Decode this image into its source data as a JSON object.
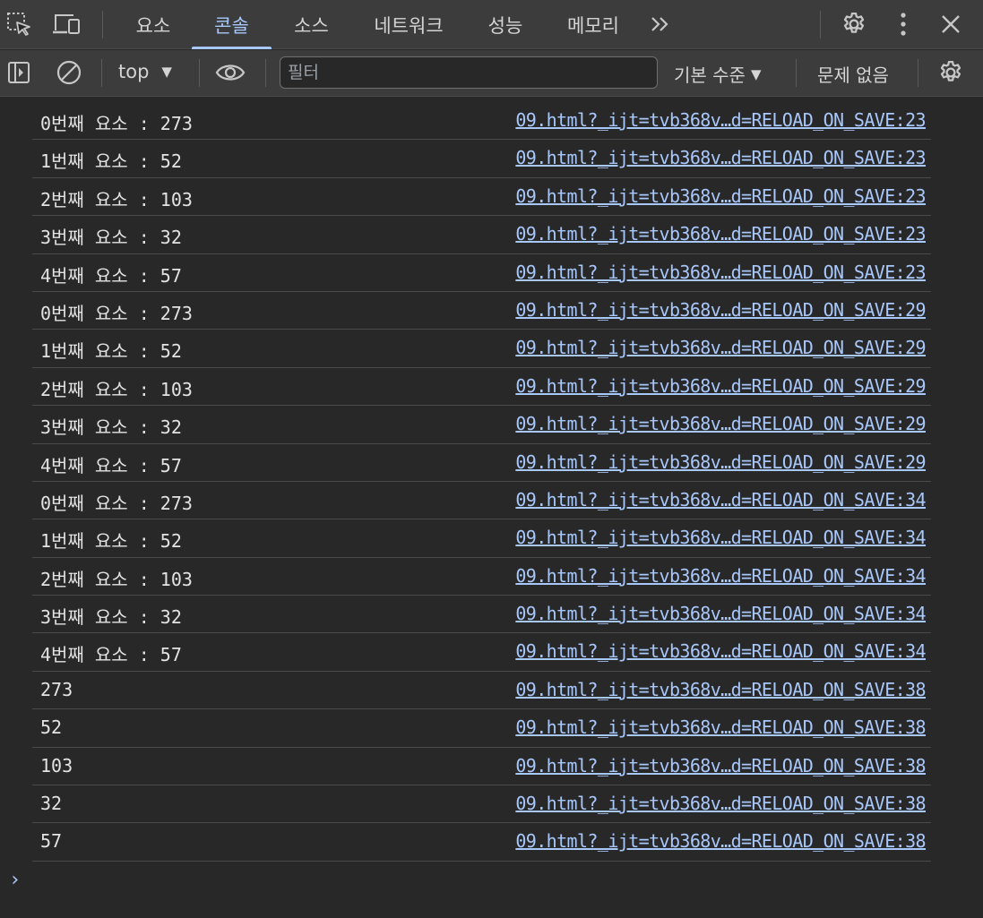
{
  "tabs": [
    {
      "label": "요소"
    },
    {
      "label": "콘솔"
    },
    {
      "label": "소스"
    },
    {
      "label": "네트워크"
    },
    {
      "label": "성능"
    },
    {
      "label": "메모리"
    }
  ],
  "active_tab": "콘솔",
  "more_tabs_label": "»",
  "toolbar": {
    "context": "top",
    "context_arrow": "▼",
    "filter_placeholder": "필터",
    "log_level": "기본 수준",
    "log_level_arrow": "▼",
    "issues": "문제 없음"
  },
  "console": {
    "messages": [
      {
        "text": "0번째 요소 : 273",
        "source": "09.html?_ijt=tvb368v…d=RELOAD_ON_SAVE:23"
      },
      {
        "text": "1번째 요소 : 52",
        "source": "09.html?_ijt=tvb368v…d=RELOAD_ON_SAVE:23"
      },
      {
        "text": "2번째 요소 : 103",
        "source": "09.html?_ijt=tvb368v…d=RELOAD_ON_SAVE:23"
      },
      {
        "text": "3번째 요소 : 32",
        "source": "09.html?_ijt=tvb368v…d=RELOAD_ON_SAVE:23"
      },
      {
        "text": "4번째 요소 : 57",
        "source": "09.html?_ijt=tvb368v…d=RELOAD_ON_SAVE:23"
      },
      {
        "text": "0번째 요소 : 273",
        "source": "09.html?_ijt=tvb368v…d=RELOAD_ON_SAVE:29"
      },
      {
        "text": "1번째 요소 : 52",
        "source": "09.html?_ijt=tvb368v…d=RELOAD_ON_SAVE:29"
      },
      {
        "text": "2번째 요소 : 103",
        "source": "09.html?_ijt=tvb368v…d=RELOAD_ON_SAVE:29"
      },
      {
        "text": "3번째 요소 : 32",
        "source": "09.html?_ijt=tvb368v…d=RELOAD_ON_SAVE:29"
      },
      {
        "text": "4번째 요소 : 57",
        "source": "09.html?_ijt=tvb368v…d=RELOAD_ON_SAVE:29"
      },
      {
        "text": "0번째 요소 : 273",
        "source": "09.html?_ijt=tvb368v…d=RELOAD_ON_SAVE:34"
      },
      {
        "text": "1번째 요소 : 52",
        "source": "09.html?_ijt=tvb368v…d=RELOAD_ON_SAVE:34"
      },
      {
        "text": "2번째 요소 : 103",
        "source": "09.html?_ijt=tvb368v…d=RELOAD_ON_SAVE:34"
      },
      {
        "text": "3번째 요소 : 32",
        "source": "09.html?_ijt=tvb368v…d=RELOAD_ON_SAVE:34"
      },
      {
        "text": "4번째 요소 : 57",
        "source": "09.html?_ijt=tvb368v…d=RELOAD_ON_SAVE:34"
      },
      {
        "text": "273",
        "source": "09.html?_ijt=tvb368v…d=RELOAD_ON_SAVE:38"
      },
      {
        "text": "52",
        "source": "09.html?_ijt=tvb368v…d=RELOAD_ON_SAVE:38"
      },
      {
        "text": "103",
        "source": "09.html?_ijt=tvb368v…d=RELOAD_ON_SAVE:38"
      },
      {
        "text": "32",
        "source": "09.html?_ijt=tvb368v…d=RELOAD_ON_SAVE:38"
      },
      {
        "text": "57",
        "source": "09.html?_ijt=tvb368v…d=RELOAD_ON_SAVE:38"
      }
    ],
    "prompt_glyph": "›"
  },
  "icons": {
    "inspect": "inspect-element-icon",
    "device": "device-toolbar-icon",
    "settings": "gear-icon",
    "menu": "kebab-menu-icon",
    "close": "close-icon",
    "sidebar": "sidebar-toggle-icon",
    "clear": "clear-console-icon",
    "eye": "live-expression-icon",
    "console_settings": "gear-icon"
  },
  "colors": {
    "background": "#282828",
    "toolbar": "#3c3c3c",
    "accent": "#a8c7fa",
    "text": "#e3e3e3"
  }
}
